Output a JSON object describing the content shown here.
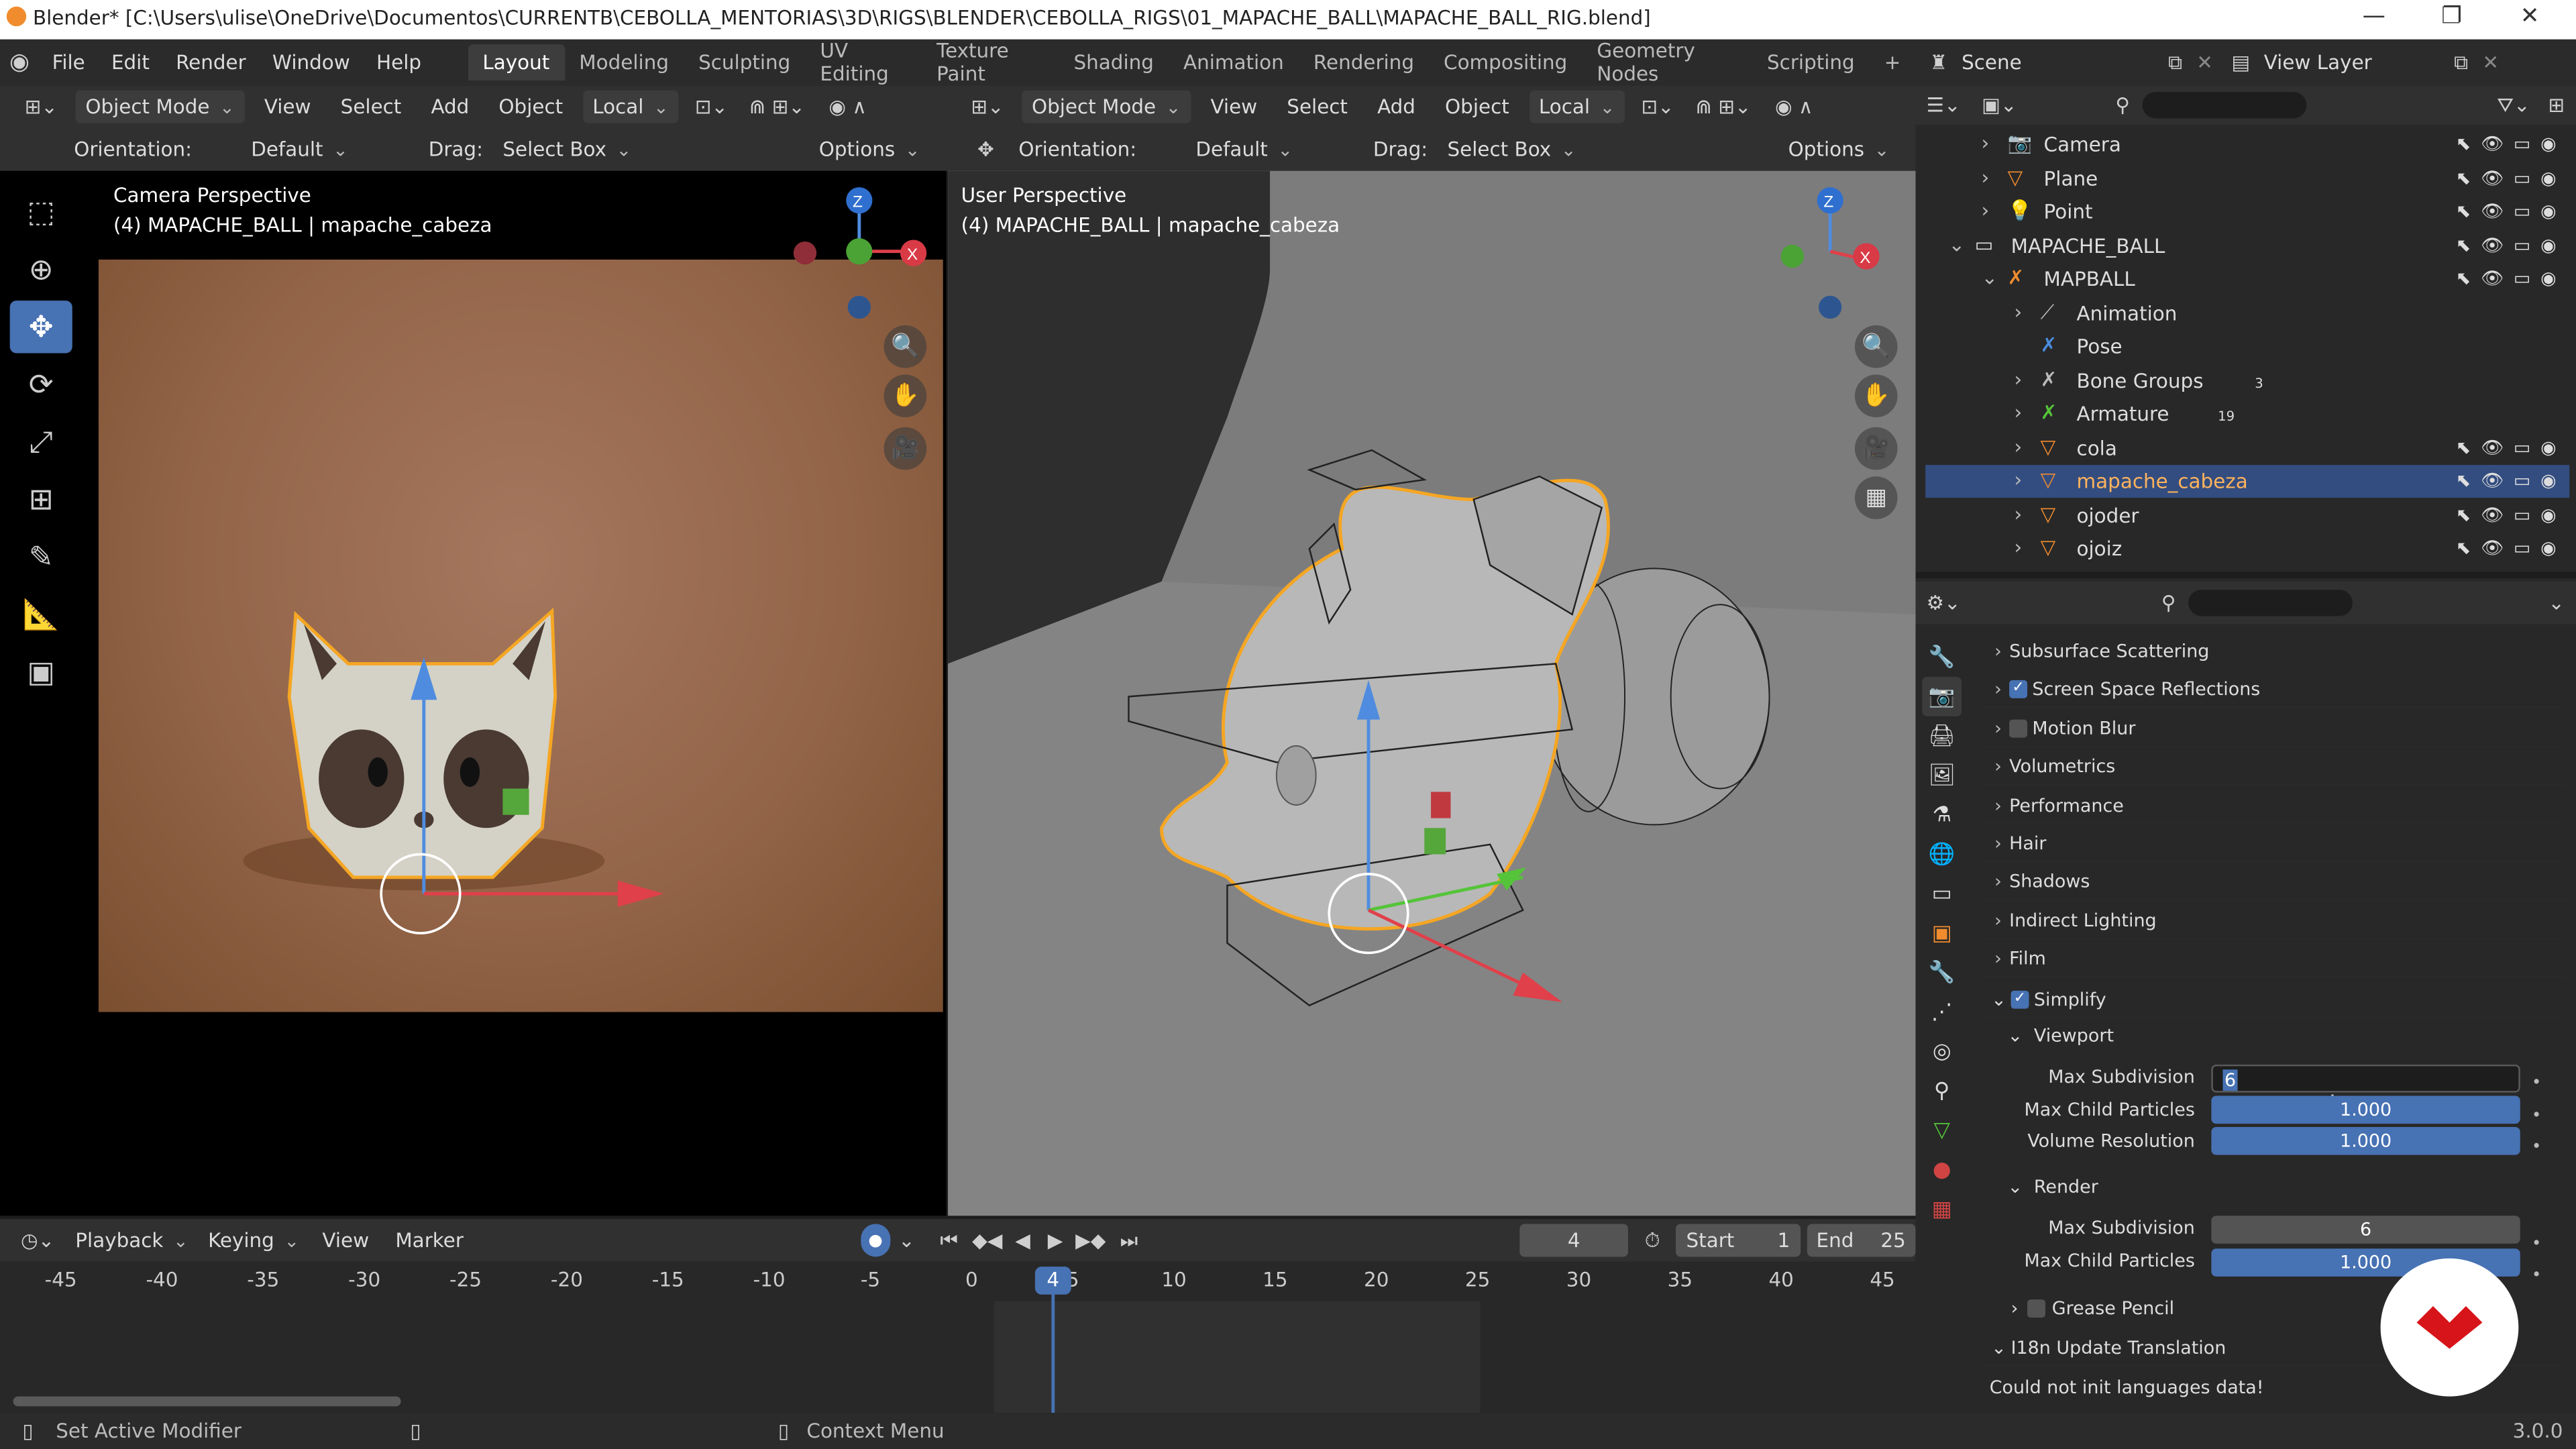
{
  "window": {
    "title": "Blender* [C:\\Users\\ulise\\OneDrive\\Documentos\\CURRENTB\\CEBOLLA_MENTORIAS\\3D\\RIGS\\BLENDER\\CEBOLLA_RIGS\\01_MAPACHE_BALL\\MAPACHE_BALL_RIG.blend]",
    "minimize": "—",
    "maximize": "❐",
    "close": "✕"
  },
  "menu": [
    "File",
    "Edit",
    "Render",
    "Window",
    "Help"
  ],
  "workspaces": [
    "Layout",
    "Modeling",
    "Sculpting",
    "UV Editing",
    "Texture Paint",
    "Shading",
    "Animation",
    "Rendering",
    "Compositing",
    "Geometry Nodes",
    "Scripting"
  ],
  "workspace_add": "+",
  "scene": {
    "label": "Scene",
    "view_layer": "View Layer"
  },
  "viewport_left": {
    "mode": "Object Mode",
    "menus": [
      "View",
      "Select",
      "Add",
      "Object"
    ],
    "transform": "Local",
    "orientation_label": "Orientation:",
    "orientation_value": "Default",
    "drag_label": "Drag:",
    "drag_value": "Select Box",
    "options": "Options",
    "title": "Camera Perspective",
    "subtitle": "(4) MAPACHE_BALL | mapache_cabeza"
  },
  "viewport_right": {
    "mode": "Object Mode",
    "menus": [
      "View",
      "Select",
      "Add",
      "Object"
    ],
    "transform": "Local",
    "orientation_label": "Orientation:",
    "orientation_value": "Default",
    "drag_label": "Drag:",
    "drag_value": "Select Box",
    "options": "Options",
    "title": "User Perspective",
    "subtitle": "(4) MAPACHE_BALL | mapache_cabeza"
  },
  "gizmo": {
    "z": "Z",
    "x": "X"
  },
  "outliner": {
    "rows": [
      {
        "label": "Camera",
        "icon": "camera-icon"
      },
      {
        "label": "Plane",
        "icon": "mesh-icon"
      },
      {
        "label": "Point",
        "icon": "light-icon"
      },
      {
        "label": "MAPACHE_BALL",
        "icon": "collection-icon"
      },
      {
        "label": "MAPBALL",
        "icon": "armature-icon"
      },
      {
        "label": "Animation",
        "icon": "animation-icon"
      },
      {
        "label": "Pose",
        "icon": "pose-icon"
      },
      {
        "label": "Bone Groups",
        "icon": "bone-groups-icon",
        "badge": "3"
      },
      {
        "label": "Armature",
        "icon": "armature-data-icon",
        "badge": "19"
      },
      {
        "label": "cola",
        "icon": "mesh-icon"
      },
      {
        "label": "mapache_cabeza",
        "icon": "mesh-icon"
      },
      {
        "label": "ojoder",
        "icon": "mesh-icon"
      },
      {
        "label": "ojoiz",
        "icon": "mesh-icon"
      }
    ]
  },
  "properties": {
    "sections": [
      {
        "label": "Subsurface Scattering",
        "checkbox": false
      },
      {
        "label": "Screen Space Reflections",
        "checkbox": true
      },
      {
        "label": "Motion Blur",
        "checkbox": false
      },
      {
        "label": "Volumetrics"
      },
      {
        "label": "Performance"
      },
      {
        "label": "Hair"
      },
      {
        "label": "Shadows"
      },
      {
        "label": "Indirect Lighting"
      },
      {
        "label": "Film"
      }
    ],
    "simplify": {
      "label": "Simplify",
      "viewport_label": "Viewport",
      "render_label": "Render",
      "fields": {
        "max_subdivision": {
          "label": "Max Subdivision",
          "value": "6"
        },
        "max_child_particles": {
          "label": "Max Child Particles",
          "value": "1.000"
        },
        "volume_resolution": {
          "label": "Volume Resolution",
          "value": "1.000"
        },
        "render_max_subdivision": {
          "label": "Max Subdivision",
          "value": "6"
        },
        "render_max_child_particles": {
          "label": "Max Child Particles",
          "value": "1.000"
        }
      }
    },
    "grease_pencil": "Grease Pencil",
    "i18n": "I18n Update Translation",
    "i18n_message": "Could not init languages data!"
  },
  "timeline": {
    "menus": [
      "Playback",
      "Keying",
      "View",
      "Marker"
    ],
    "current_frame": "4",
    "start_label": "Start",
    "start": "1",
    "end_label": "End",
    "end": "25",
    "ticks": [
      "-45",
      "-40",
      "-35",
      "-30",
      "-25",
      "-20",
      "-15",
      "-10",
      "-5",
      "0",
      "5",
      "10",
      "15",
      "20",
      "25",
      "30",
      "35",
      "40",
      "45"
    ]
  },
  "statusbar": {
    "left": "Set Active Modifier",
    "middle": "Context Menu",
    "version": "3.0.0"
  },
  "colors": {
    "accent": "#4772b3",
    "selection": "#334d80",
    "orange": "#f5a623"
  }
}
